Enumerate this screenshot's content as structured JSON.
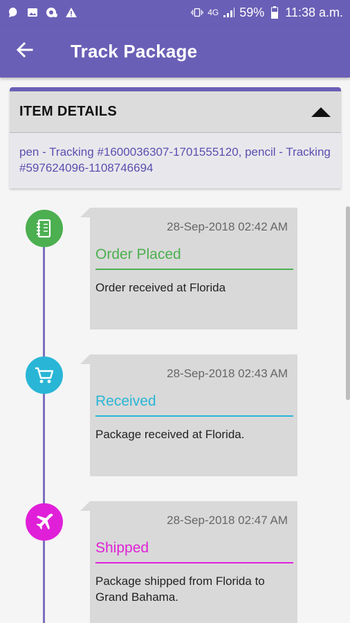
{
  "status_bar": {
    "battery": "59%",
    "time": "11:38 a.m.",
    "network": "4G"
  },
  "app_bar": {
    "title": "Track Package"
  },
  "item_details": {
    "title": "ITEM DETAILS",
    "text": "pen - Tracking #1600036307-1701555120, pencil - Tracking #597624096-1108746694"
  },
  "events": [
    {
      "time": "28-Sep-2018 02:42 AM",
      "status": "Order Placed",
      "description": "Order received at Florida",
      "color": "#4caf50",
      "icon": "notebook-icon"
    },
    {
      "time": "28-Sep-2018 02:43 AM",
      "status": "Received",
      "description": "Package received at Florida.",
      "color": "#29b6d6",
      "icon": "cart-icon"
    },
    {
      "time": "28-Sep-2018 02:47 AM",
      "status": "Shipped",
      "description": "Package shipped from Florida to Grand Bahama.",
      "color": "#e020d8",
      "icon": "airplane-icon"
    }
  ]
}
